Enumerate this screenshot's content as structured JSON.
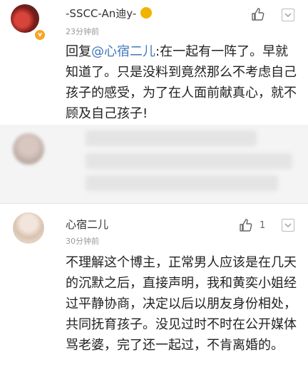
{
  "comments": [
    {
      "username": "-SSCC-An迪y-",
      "time": "23分钟前",
      "reply_prefix": "回复",
      "mention": "@心宿二儿",
      "text": ":在一起有一阵了。早就知道了。只是没料到竟然那么不考虑自己孩子的感受，为了在人面前献真心，就不顾及自己孩子!"
    },
    {
      "blurred": true
    },
    {
      "username": "心宿二儿",
      "time": "30分钟前",
      "like_count": "1",
      "text": "不理解这个博主，正常男人应该是在几天的沉默之后，直接声明，我和黄奕小姐经过平静协商，决定以后以朋友身份相处，共同抚育孩子。没见过时不时在公开媒体骂老婆，完了还一起过，不肯离婚的。"
    }
  ],
  "colors": {
    "mention": "#3f78bb",
    "verified_badge": "#f5a623"
  },
  "icons": [
    "like-icon",
    "dropdown-chevron-icon",
    "verified-badge-icon"
  ]
}
